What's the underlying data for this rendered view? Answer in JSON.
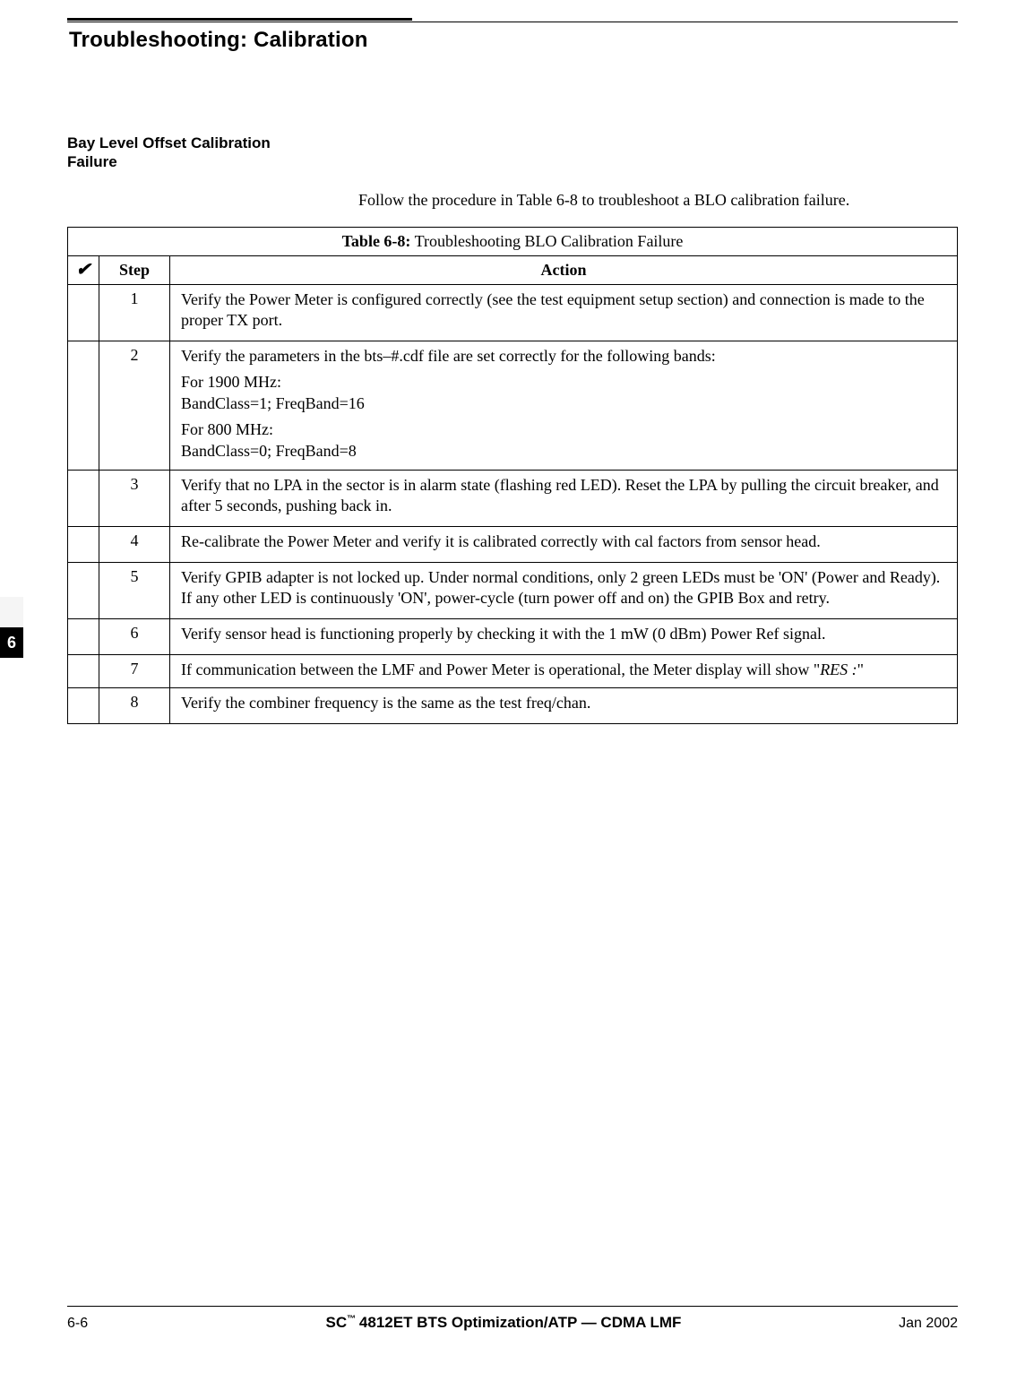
{
  "page_title": "Troubleshooting: Calibration",
  "section_heading": "Bay Level Offset Calibration Failure",
  "intro": "Follow the procedure in Table 6-8 to troubleshoot a BLO calibration failure.",
  "side_tab": "6",
  "table": {
    "title_bold": "Table 6-8:",
    "title_rest": " Troubleshooting BLO Calibration Failure",
    "headers": {
      "check": "✔",
      "step": "Step",
      "action": "Action"
    },
    "rows": [
      {
        "step": "1",
        "action_lines": [
          "Verify the Power Meter is configured correctly (see the test equipment setup section) and connection is made to the proper TX port."
        ]
      },
      {
        "step": "2",
        "action_lines": [
          "Verify the parameters in the bts–#.cdf file are set correctly for the following bands:",
          "For 1900 MHz:",
          "BandClass=1; FreqBand=16",
          "For 800 MHz:",
          "BandClass=0; FreqBand=8"
        ]
      },
      {
        "step": "3",
        "action_lines": [
          "Verify that no LPA in the sector is in alarm state (flashing red LED). Reset the LPA by pulling the circuit breaker, and after 5 seconds, pushing back in."
        ]
      },
      {
        "step": "4",
        "action_lines": [
          "Re-calibrate the Power Meter and verify it is calibrated correctly with cal factors from sensor head."
        ]
      },
      {
        "step": "5",
        "action_lines": [
          "Verify GPIB adapter is not locked up. Under normal conditions, only 2 green LEDs must be 'ON' (Power and Ready). If any other LED is continuously 'ON', power-cycle (turn power off and on) the GPIB Box and retry."
        ]
      },
      {
        "step": "6",
        "action_lines": [
          "Verify sensor head is functioning properly by checking it with the 1 mW (0 dBm) Power Ref signal."
        ]
      },
      {
        "step": "7",
        "action_lines_html": "If communication between the LMF and Power Meter is operational, the Meter display will show \"<span class=\"res\">RES :</span>\""
      },
      {
        "step": "8",
        "action_lines": [
          "Verify the combiner frequency is the same as the test freq/chan."
        ]
      }
    ]
  },
  "footer": {
    "left": "6-6",
    "center_prefix": "SC",
    "center_tm": "™",
    "center_rest": "4812ET BTS Optimization/ATP — CDMA LMF",
    "right": "Jan 2002"
  }
}
